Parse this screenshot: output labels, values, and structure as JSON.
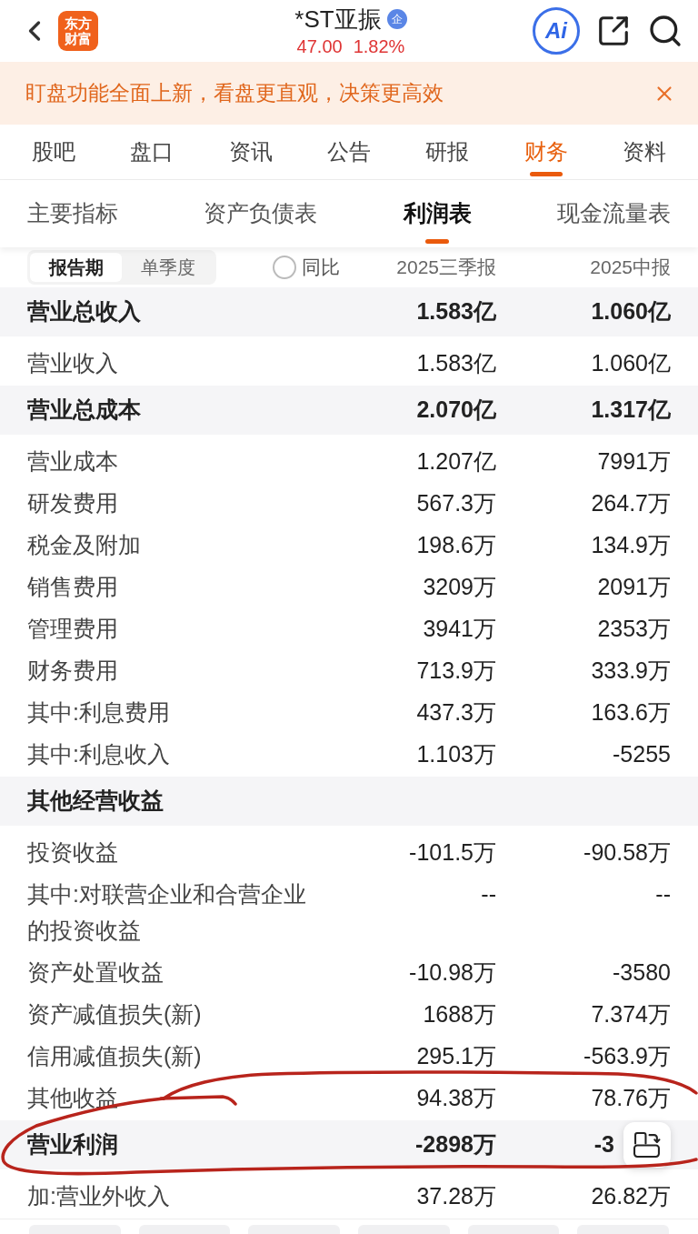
{
  "header": {
    "logo": "东方财富",
    "title": "*ST亚振",
    "badge": "企",
    "price": "47.00",
    "change": "1.82%",
    "ai_button": "Ai"
  },
  "banner": {
    "text": "盯盘功能全面上新，看盘更直观，决策更高效"
  },
  "tabs": [
    {
      "label": "股吧",
      "selected": false
    },
    {
      "label": "盘口",
      "selected": false
    },
    {
      "label": "资讯",
      "selected": false
    },
    {
      "label": "公告",
      "selected": false
    },
    {
      "label": "研报",
      "selected": false
    },
    {
      "label": "财务",
      "selected": true
    },
    {
      "label": "资料",
      "selected": false
    }
  ],
  "sub_tabs": [
    {
      "label": "主要指标",
      "selected": false
    },
    {
      "label": "资产负债表",
      "selected": false
    },
    {
      "label": "利润表",
      "selected": true
    },
    {
      "label": "现金流量表",
      "selected": false
    }
  ],
  "table": {
    "period_toggle": [
      {
        "label": "报告期",
        "selected": true
      },
      {
        "label": "单季度",
        "selected": false
      }
    ],
    "yoy": {
      "label": "同比",
      "checked": false
    },
    "columns": [
      "2025三季报",
      "2025中报"
    ],
    "rows": [
      {
        "kind": "header",
        "label": "营业总收入",
        "values": [
          "1.583亿",
          "1.060亿"
        ]
      },
      {
        "kind": "item",
        "label": "营业收入",
        "values": [
          "1.583亿",
          "1.060亿"
        ]
      },
      {
        "kind": "header",
        "label": "营业总成本",
        "values": [
          "2.070亿",
          "1.317亿"
        ]
      },
      {
        "kind": "item",
        "label": "营业成本",
        "values": [
          "1.207亿",
          "7991万"
        ]
      },
      {
        "kind": "item",
        "label": "研发费用",
        "values": [
          "567.3万",
          "264.7万"
        ]
      },
      {
        "kind": "item",
        "label": "税金及附加",
        "values": [
          "198.6万",
          "134.9万"
        ]
      },
      {
        "kind": "item",
        "label": "销售费用",
        "values": [
          "3209万",
          "2091万"
        ]
      },
      {
        "kind": "item",
        "label": "管理费用",
        "values": [
          "3941万",
          "2353万"
        ]
      },
      {
        "kind": "item",
        "label": "财务费用",
        "values": [
          "713.9万",
          "333.9万"
        ]
      },
      {
        "kind": "item",
        "label": "其中:利息费用",
        "values": [
          "437.3万",
          "163.6万"
        ]
      },
      {
        "kind": "item",
        "label": "其中:利息收入",
        "values": [
          "1.103万",
          "-5255"
        ]
      },
      {
        "kind": "header",
        "label": "其他经营收益"
      },
      {
        "kind": "item",
        "label": "投资收益",
        "values": [
          "-101.5万",
          "-90.58万"
        ]
      },
      {
        "kind": "item",
        "label": "其中:对联营企业和合营企业的投资收益",
        "values": [
          "--",
          "--"
        ]
      },
      {
        "kind": "item",
        "label": "资产处置收益",
        "values": [
          "-10.98万",
          "-3580"
        ]
      },
      {
        "kind": "item",
        "label": "资产减值损失(新)",
        "values": [
          "1688万",
          "7.374万"
        ]
      },
      {
        "kind": "item",
        "label": "信用减值损失(新)",
        "values": [
          "295.1万",
          "-563.9万"
        ]
      },
      {
        "kind": "item",
        "label": "其他收益",
        "values": [
          "94.38万",
          "78.76万"
        ]
      },
      {
        "kind": "header",
        "label": "营业利润",
        "values": [
          "-2898万",
          "-3"
        ],
        "floating_button": true,
        "circled": true
      },
      {
        "kind": "item",
        "label": "加:营业外收入",
        "values": [
          "37.28万",
          "26.82万"
        ]
      }
    ]
  }
}
